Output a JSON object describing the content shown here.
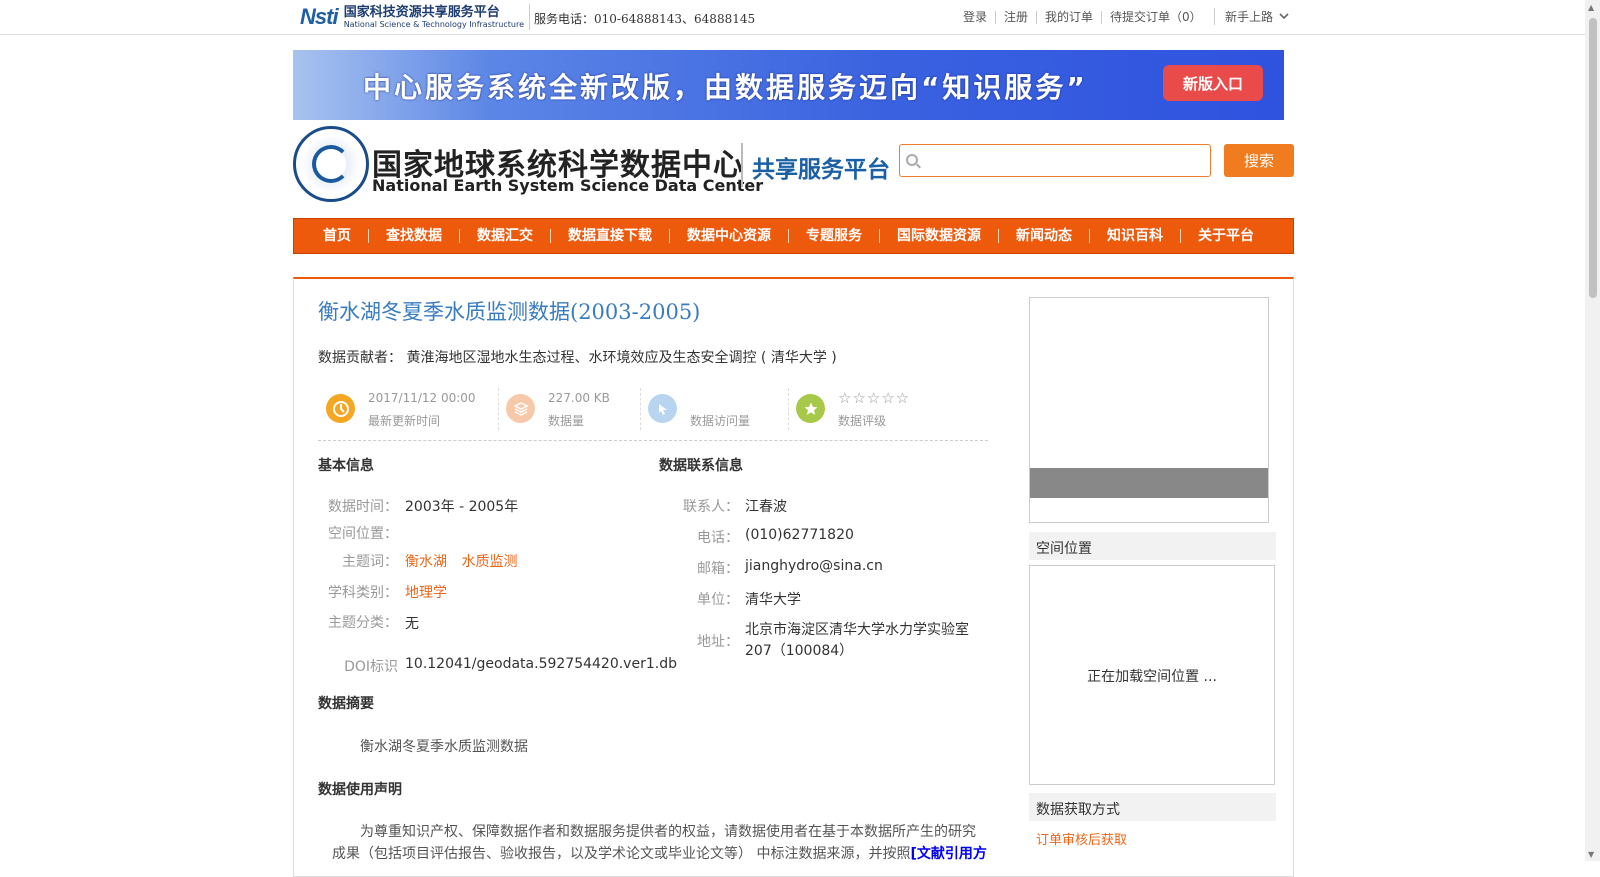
{
  "topbar": {
    "logo_mark": "Nsti",
    "logo_cn": "国家科技资源共享服务平台",
    "logo_en": "National Science & Technology Infrastructure",
    "service_phone": "服务电话：010-64888143、64888145",
    "links": [
      "登录",
      "注册",
      "我的订单",
      "待提交订单（0）"
    ],
    "newbie": "新手上路"
  },
  "banner": {
    "text": "中心服务系统全新改版，由数据服务迈向“知识服务”",
    "button": "新版入口"
  },
  "header": {
    "center_cn": "国家地球系统科学数据中心",
    "center_en": "National Earth System Science Data Center",
    "platform": "共享服务平台",
    "search_placeholder": "",
    "search_button": "搜索"
  },
  "nav": [
    "首页",
    "查找数据",
    "数据汇交",
    "数据直接下载",
    "数据中心资源",
    "专题服务",
    "国际数据资源",
    "新闻动态",
    "知识百科",
    "关于平台"
  ],
  "dataset": {
    "title": "衡水湖冬夏季水质监测数据(2003-2005)",
    "contributor_label": "数据贡献者：",
    "contributor": "黄淮海地区湿地水生态过程、水环境效应及生态安全调控 ( 清华大学 )",
    "stats": [
      {
        "value": "2017/11/12 00:00",
        "label": "最新更新时间",
        "color": "#f5a623"
      },
      {
        "value": "227.00 KB",
        "label": "数据量",
        "color": "#f7c9a8"
      },
      {
        "value": "",
        "label": "数据访问量",
        "color": "#b8d4ee"
      },
      {
        "value": "☆☆☆☆☆",
        "label": "数据评级",
        "color": "#a8c84a"
      }
    ]
  },
  "basic_info": {
    "heading": "基本信息",
    "time_label": "数据时间：",
    "time_value": "2003年 - 2005年",
    "space_label": "空间位置：",
    "keywords_label": "主题词：",
    "keywords": [
      "衡水湖",
      "水质监测"
    ],
    "discipline_label": "学科类别：",
    "discipline": "地理学",
    "category_label": "主题分类：",
    "category": "无",
    "doi_label": "DOI标识",
    "doi": "10.12041/geodata.592754420.ver1.db"
  },
  "contact_info": {
    "heading": "数据联系信息",
    "contact_label": "联系人：",
    "contact": "江春波",
    "phone_label": "电话：",
    "phone": "(010)62771820",
    "email_label": "邮箱：",
    "email": "jianghydro@sina.cn",
    "org_label": "单位：",
    "org": "清华大学",
    "address_label": "地址：",
    "address_line1": "北京市海淀区清华大学水力学实验室",
    "address_line2": "207（100084）"
  },
  "abstract": {
    "heading": "数据摘要",
    "text": "衡水湖冬夏季水质监测数据"
  },
  "usage": {
    "heading": "数据使用声明",
    "line1": "为尊重知识产权、保障数据作者和数据服务提供者的权益，请数据使用者在基于本数据所产生的研究",
    "line2": "成果（包括项目评估报告、验收报告，以及学术论文或毕业论文等） 中标注数据来源，并按照",
    "link": "[文献引用方"
  },
  "sidebar": {
    "spatial_heading": "空间位置",
    "map_loading": "正在加载空间位置 ...",
    "acquire_heading": "数据获取方式",
    "acquire_link": "订单审核后获取"
  }
}
